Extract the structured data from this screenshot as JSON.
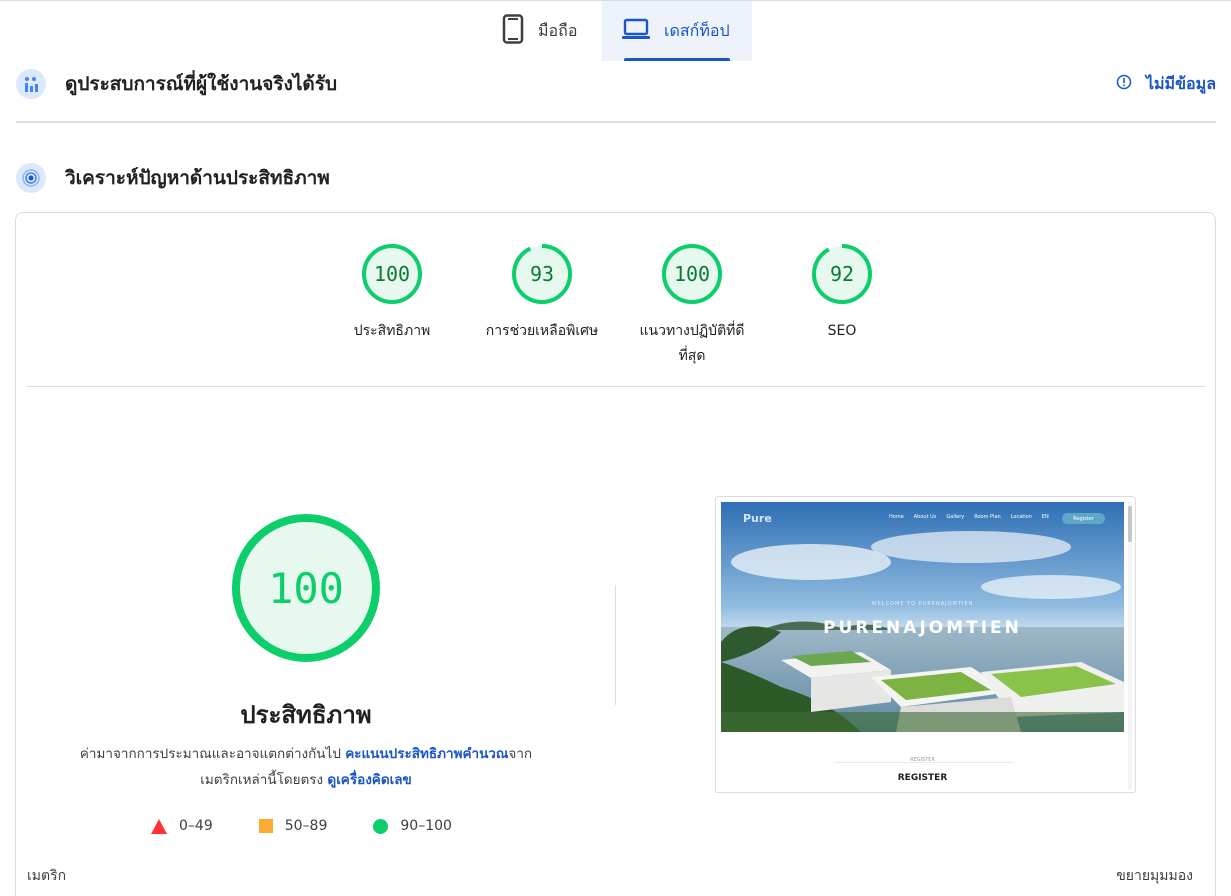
{
  "tabs": {
    "mobile": {
      "label": "มือถือ",
      "icon": "phone-icon"
    },
    "desktop": {
      "label": "เดสก์ท็อป",
      "icon": "laptop-icon",
      "selected": true
    }
  },
  "real_user": {
    "title": "ดูประสบการณ์ที่ผู้ใช้งานจริงได้รับ",
    "status": "ไม่มีข้อมูล",
    "icon": "analytics-icon",
    "status_icon": "info-icon"
  },
  "diagnose": {
    "title": "วิเคราะห์ปัญหาด้านประสิทธิภาพ",
    "icon": "lighthouse-icon"
  },
  "scores": [
    {
      "value": "100",
      "label": "ประสิทธิภาพ",
      "fraction": 1.0
    },
    {
      "value": "93",
      "label": "การช่วยเหลือพิเศษ",
      "fraction": 0.93
    },
    {
      "value": "100",
      "label": "แนวทางปฏิบัติที่ดีที่สุด",
      "fraction": 1.0
    },
    {
      "value": "92",
      "label": "SEO",
      "fraction": 0.92
    }
  ],
  "performance": {
    "score": "100",
    "fraction": 1.0,
    "title": "ประสิทธิภาพ",
    "desc_text1": "ค่ามาจากการประมาณและอาจแตกต่างกันไป",
    "desc_link1": "คะแนนประสิทธิภาพคำนวณ",
    "desc_text2": "จาก",
    "desc_text3": "เมตริกเหล่านี้โดยตรง",
    "desc_link2": "ดูเครื่องคิดเลข"
  },
  "legend": {
    "fail": "0–49",
    "average": "50–89",
    "pass": "90–100"
  },
  "screenshot": {
    "logo": "Pure",
    "menu": [
      "Home",
      "About Us",
      "Gallery",
      "Room Plan",
      "Location",
      "EN"
    ],
    "register_button": "Register",
    "welcome": "WELCOME TO PURENAJOMTIEN",
    "brand": "PURENAJOMTIEN",
    "sub_small": "REGISTER",
    "sub_heading": "REGISTER"
  },
  "footer": {
    "metrics": "เมตริก",
    "expand": "ขยายมุมมอง"
  },
  "colors": {
    "accent": "#1a56c8",
    "pass": "#0cce6b",
    "pass_text": "#0b7a33",
    "pass_fill": "#e7f8ee",
    "average": "#ffaa33",
    "fail": "#ff3333"
  }
}
